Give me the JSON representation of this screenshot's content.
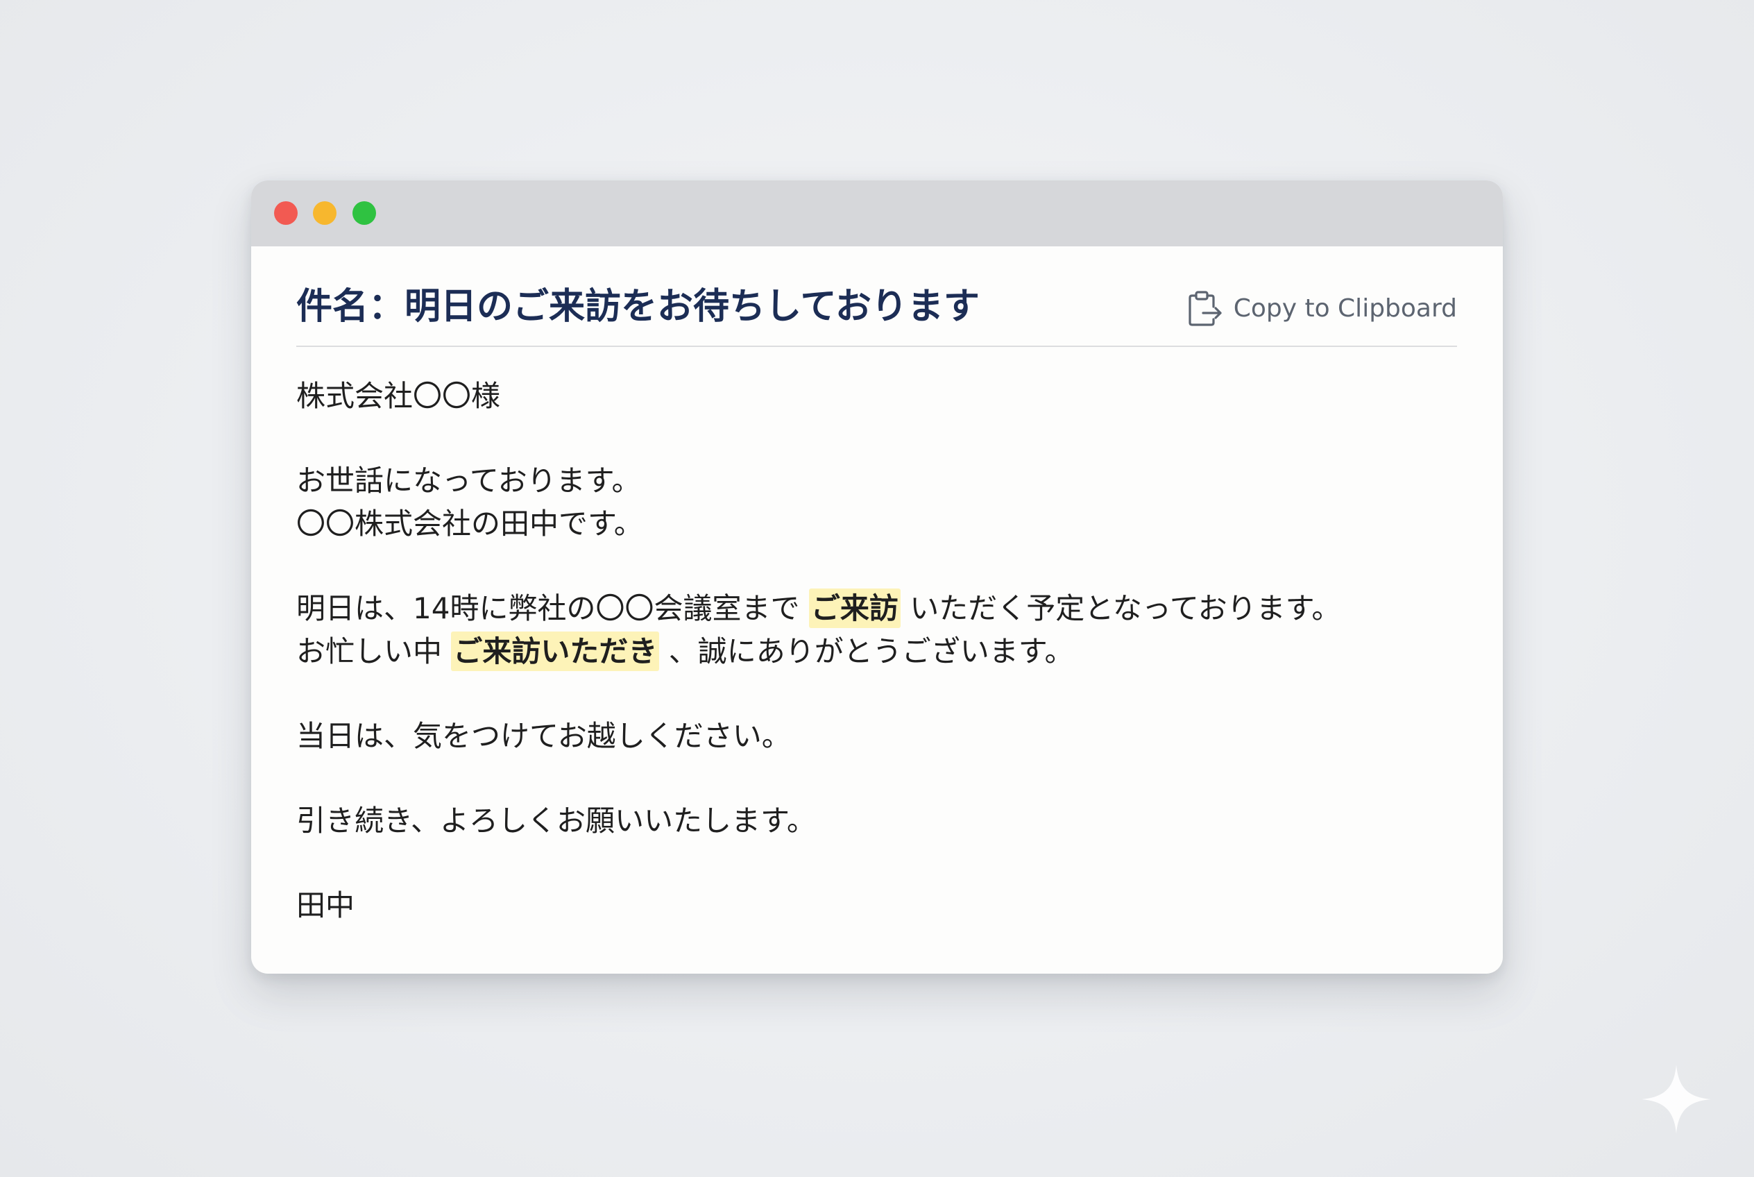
{
  "email": {
    "subject": "件名：明日のご来訪をお待ちしております",
    "copy_label": "Copy to Clipboard",
    "addressee": "株式会社〇〇様",
    "greeting_1": "お世話になっております。",
    "greeting_2": "〇〇株式会社の田中です。",
    "p1_line1_before": "明日は、14時に弊社の〇〇会議室まで",
    "p1_line1_highlight": "ご来訪",
    "p1_line1_after": "いただく予定となっております。",
    "p1_line2_before": "お忙しい中",
    "p1_line2_highlight": "ご来訪いただき",
    "p1_line2_after": "、誠にありがとうございます。",
    "p2": "当日は、気をつけてお越しください。",
    "closing": "引き続き、よろしくお願いいたします。",
    "signature": "田中"
  },
  "colors": {
    "window_background": "#fdfdfc",
    "titlebar": "#d6d7da",
    "subject_text": "#1c2d55",
    "highlight": "#fdf3b8",
    "traffic_red": "#f25a52",
    "traffic_yellow": "#f7b72e",
    "traffic_green": "#2fc241"
  },
  "icons": {
    "copy": "clipboard-export-icon",
    "watermark": "sparkle-icon"
  }
}
